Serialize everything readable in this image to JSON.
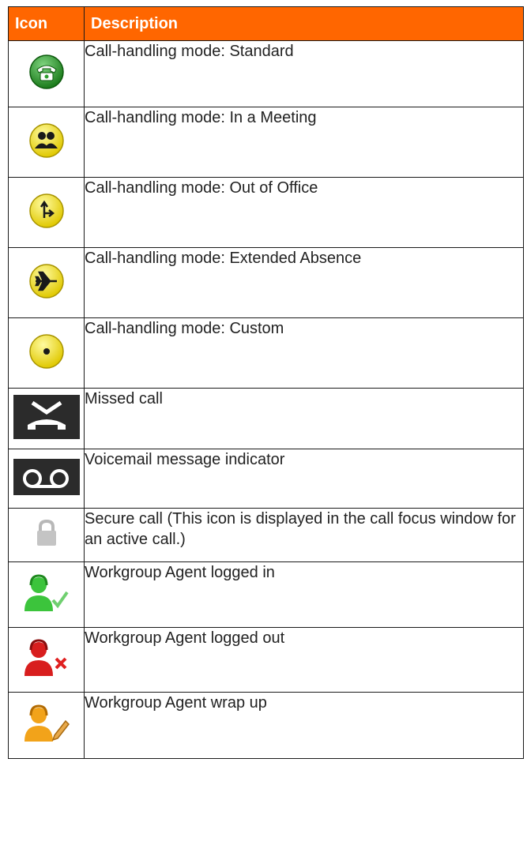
{
  "header": {
    "icon_col": "Icon",
    "desc_col": "Description"
  },
  "rows": [
    {
      "icon": "standard-phone-icon",
      "description": "Call-handling mode: Standard"
    },
    {
      "icon": "in-meeting-icon",
      "description": "Call-handling mode: In a Meeting"
    },
    {
      "icon": "out-of-office-icon",
      "description": "Call-handling mode: Out of Office"
    },
    {
      "icon": "extended-absence-icon",
      "description": "Call-handling mode: Extended Absence"
    },
    {
      "icon": "custom-mode-icon",
      "description": "Call-handling mode: Custom"
    },
    {
      "icon": "missed-call-icon",
      "description": "Missed call"
    },
    {
      "icon": "voicemail-icon",
      "description": "Voicemail message indicator"
    },
    {
      "icon": "lock-icon",
      "description": "Secure call (This icon is displayed in the call focus window for an active call.)"
    },
    {
      "icon": "agent-logged-in-icon",
      "description": "Workgroup Agent logged in"
    },
    {
      "icon": "agent-logged-out-icon",
      "description": "Workgroup Agent logged out"
    },
    {
      "icon": "agent-wrap-up-icon",
      "description": "Workgroup Agent wrap up"
    }
  ],
  "colors": {
    "header_bg": "#ff6600",
    "green": "#2e9e2e",
    "yellow": "#f5e313",
    "red": "#d81e1e",
    "orange": "#f2a31a"
  }
}
